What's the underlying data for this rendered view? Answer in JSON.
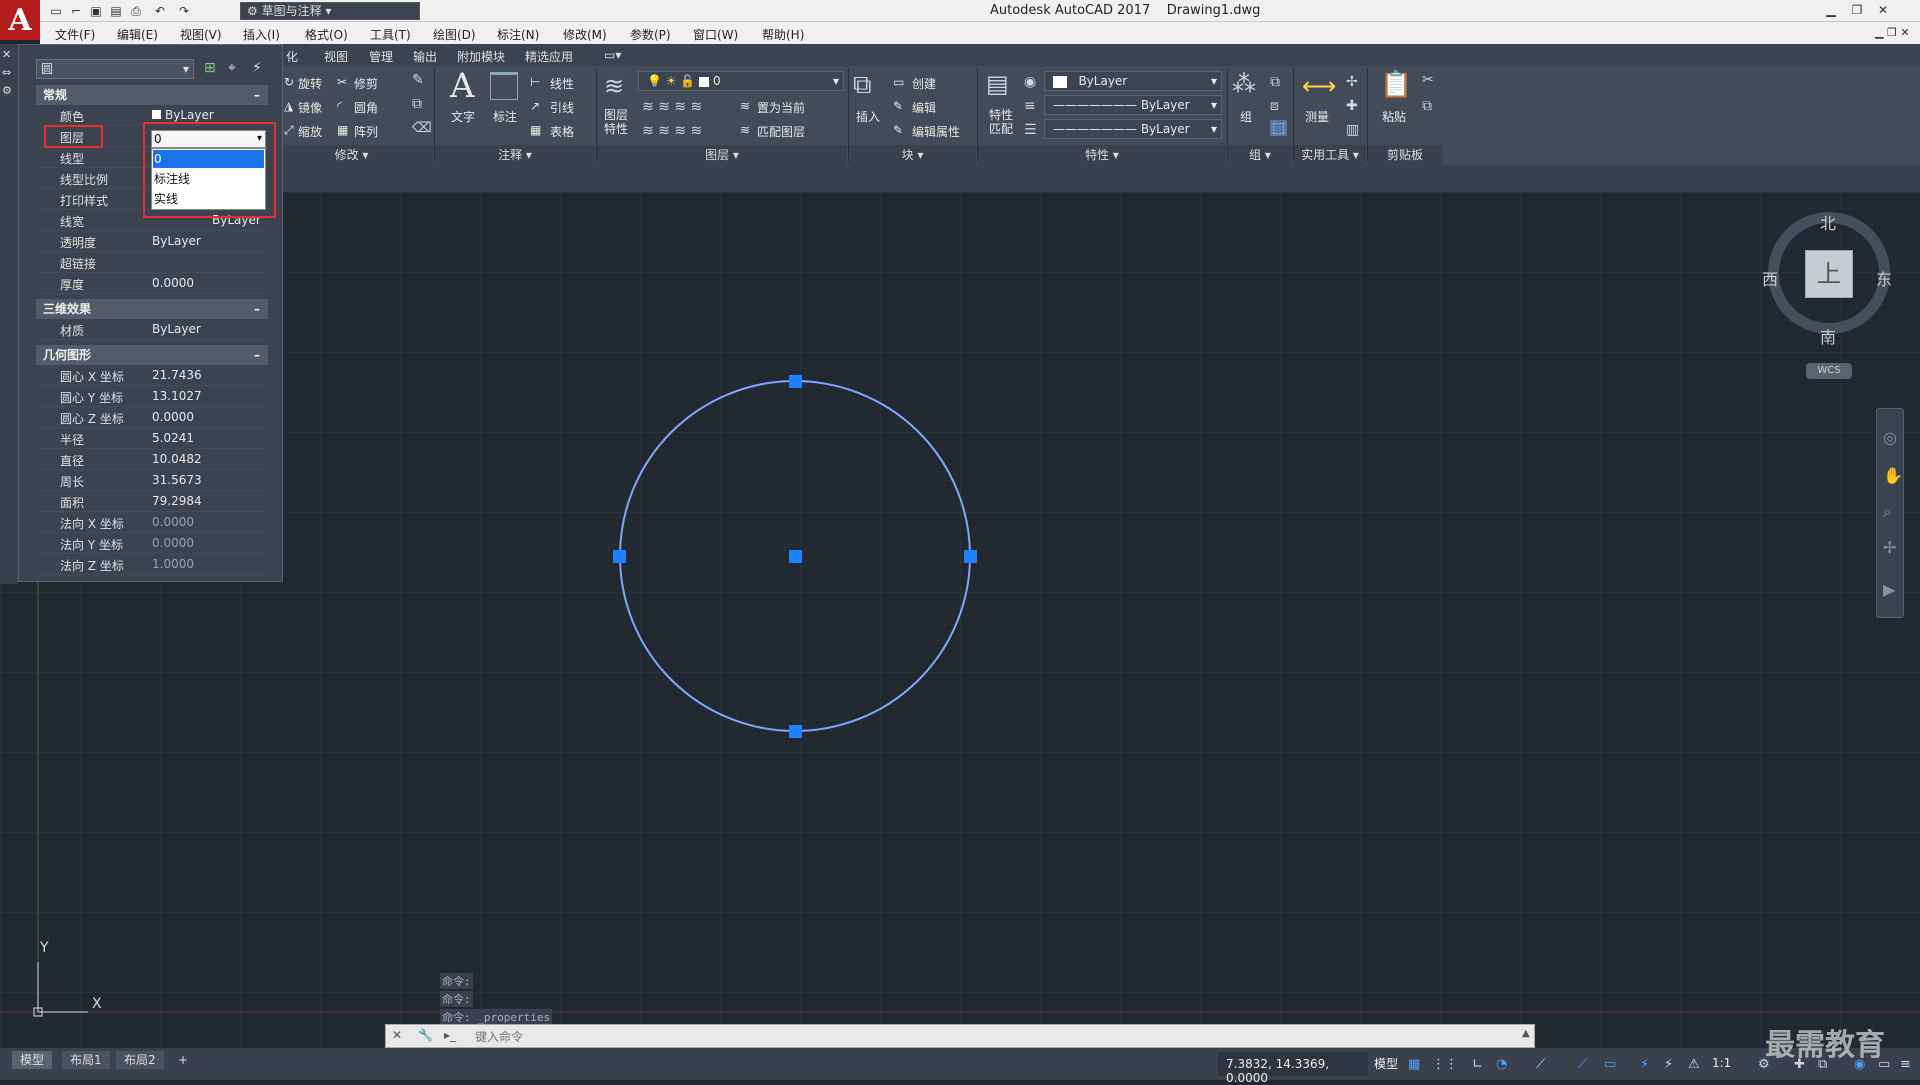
{
  "app": {
    "title": "Autodesk AutoCAD 2017",
    "file": "Drawing1.dwg",
    "logo": "A",
    "workspace": "草图与注释"
  },
  "menu": [
    "文件(F)",
    "编辑(E)",
    "视图(V)",
    "插入(I)",
    "格式(O)",
    "工具(T)",
    "绘图(D)",
    "标注(N)",
    "修改(M)",
    "参数(P)",
    "窗口(W)",
    "帮助(H)"
  ],
  "ribbon_tabs": [
    "化",
    "视图",
    "管理",
    "输出",
    "附加模块",
    "精选应用"
  ],
  "ribbon": {
    "modify": {
      "rotate": "旋转",
      "trim": "修剪",
      "mirror": "镜像",
      "fillet": "圆角",
      "scale": "缩放",
      "array": "阵列",
      "panel": "修改"
    },
    "annotation": {
      "text": "文字",
      "dimension": "标注",
      "linear": "线性",
      "leader": "引线",
      "table": "表格",
      "panel": "注释"
    },
    "layers": {
      "props": "图层\n特性",
      "current_layer": "0",
      "set_current": "置为当前",
      "match": "匹配图层",
      "panel": "图层"
    },
    "block": {
      "insert": "插入",
      "create": "创建",
      "edit": "编辑",
      "edit_attr": "编辑属性",
      "panel": "块"
    },
    "properties": {
      "match": "特性\n匹配",
      "color": "ByLayer",
      "linetype": "ByLayer",
      "lineweight": "ByLayer",
      "panel": "特性"
    },
    "groups": {
      "group": "组",
      "panel": "组"
    },
    "utilities": {
      "measure": "测量",
      "panel": "实用工具"
    },
    "clipboard": {
      "paste": "粘贴",
      "panel": "剪贴板"
    }
  },
  "palette": {
    "object_type": "圆",
    "sections": {
      "general": "常规",
      "3d": "三维效果",
      "geometry": "几何图形"
    },
    "general_rows": [
      {
        "name": "颜色",
        "value": "ByLayer"
      },
      {
        "name": "图层",
        "value": "0"
      },
      {
        "name": "线型",
        "value": ""
      },
      {
        "name": "线型比例",
        "value": ""
      },
      {
        "name": "打印样式",
        "value": ""
      },
      {
        "name": "线宽",
        "value": "ByLayer"
      },
      {
        "name": "透明度",
        "value": "ByLayer"
      },
      {
        "name": "超链接",
        "value": ""
      },
      {
        "name": "厚度",
        "value": "0.0000"
      }
    ],
    "threed_rows": [
      {
        "name": "材质",
        "value": "ByLayer"
      }
    ],
    "geometry_rows": [
      {
        "name": "圆心 X 坐标",
        "value": "21.7436"
      },
      {
        "name": "圆心 Y 坐标",
        "value": "13.1027"
      },
      {
        "name": "圆心 Z 坐标",
        "value": "0.0000"
      },
      {
        "name": "半径",
        "value": "5.0241"
      },
      {
        "name": "直径",
        "value": "10.0482"
      },
      {
        "name": "周长",
        "value": "31.5673"
      },
      {
        "name": "面积",
        "value": "79.2984"
      },
      {
        "name": "法向 X 坐标",
        "value": "0.0000"
      },
      {
        "name": "法向 Y 坐标",
        "value": "0.0000"
      },
      {
        "name": "法向 Z 坐标",
        "value": "1.0000"
      }
    ],
    "layer_dropdown": {
      "selected": "0",
      "options": [
        "0",
        "标注线",
        "实线"
      ]
    }
  },
  "viewcube": {
    "north": "北",
    "south": "南",
    "east": "东",
    "west": "西",
    "top": "上",
    "wcs": "WCS"
  },
  "ucs": {
    "x": "X",
    "y": "Y"
  },
  "command": {
    "history": [
      "命令:",
      "命令:",
      "命令: _properties"
    ],
    "placeholder": "键入命令"
  },
  "layout_tabs": [
    "模型",
    "布局1",
    "布局2",
    "+"
  ],
  "status": {
    "coords": "7.3832, 14.3369, 0.0000",
    "model": "模型",
    "scale": "1:1"
  },
  "watermark": "最需教育",
  "colors": {
    "background": "#212830",
    "circle": "#7ea6ff",
    "grip": "#1e82ff",
    "highlight": "#e03030"
  }
}
